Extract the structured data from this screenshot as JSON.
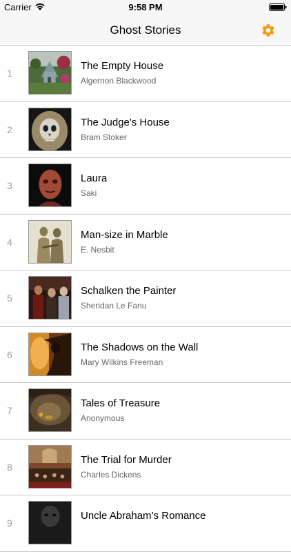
{
  "status_bar": {
    "carrier": "Carrier",
    "time": "9:58 PM"
  },
  "nav": {
    "title": "Ghost Stories",
    "settings_icon": "gear-icon",
    "accent_color": "#f39c12"
  },
  "stories": [
    {
      "number": "1",
      "title": "The Empty House",
      "author": "Algernon Blackwood"
    },
    {
      "number": "2",
      "title": "The Judge's House",
      "author": "Bram Stoker"
    },
    {
      "number": "3",
      "title": "Laura",
      "author": "Saki"
    },
    {
      "number": "4",
      "title": "Man-size in Marble",
      "author": "E. Nesbit"
    },
    {
      "number": "5",
      "title": "Schalken the Painter",
      "author": "Sheridan Le Fanu"
    },
    {
      "number": "6",
      "title": "The Shadows on the Wall",
      "author": "Mary Wilkins Freeman"
    },
    {
      "number": "7",
      "title": "Tales of Treasure",
      "author": "Anonymous"
    },
    {
      "number": "8",
      "title": "The Trial for Murder",
      "author": "Charles Dickens"
    },
    {
      "number": "9",
      "title": "Uncle Abraham’s Romance",
      "author": ""
    }
  ]
}
